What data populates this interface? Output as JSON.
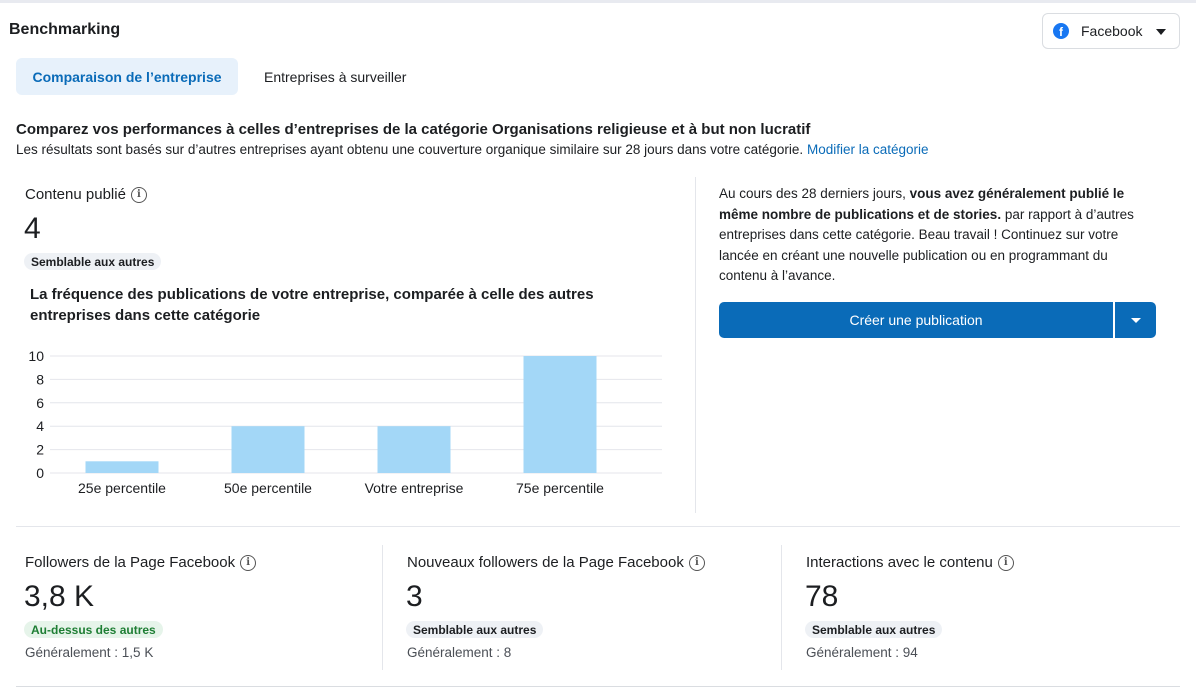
{
  "header": {
    "title": "Benchmarking",
    "platform": "Facebook"
  },
  "tabs": [
    {
      "label": "Comparaison de l’entreprise",
      "active": true
    },
    {
      "label": "Entreprises à surveiller",
      "active": false
    }
  ],
  "intro": {
    "headline": "Comparez vos performances à celles d’entreprises de la catégorie Organisations religieuse et à but non lucratif",
    "subline": "Les résultats sont basés sur d’autres entreprises ayant obtenu une couverture organique similaire sur 28 jours dans votre catégorie.",
    "link": "Modifier la catégorie"
  },
  "content_metric": {
    "label": "Contenu publié",
    "value": "4",
    "badge": "Semblable aux autres"
  },
  "chart_title": "La fréquence des publications de votre entreprise, comparée à celle des autres entreprises dans cette catégorie",
  "chart_data": {
    "type": "bar",
    "categories": [
      "25e percentile",
      "50e percentile",
      "Votre entreprise",
      "75e percentile"
    ],
    "values": [
      1,
      4,
      4,
      10
    ],
    "yticks": [
      0,
      2,
      4,
      6,
      8,
      10
    ],
    "ylim": [
      0,
      10
    ],
    "grid": true,
    "bar_color": "#a3d7f7"
  },
  "insight": {
    "prefix": "Au cours des 28 derniers jours, ",
    "bold": "vous avez généralement publié le même nombre de publications et de stories.",
    "suffix": " par rapport à d’autres entreprises dans cette catégorie. Beau travail ! Continuez sur votre lancée en créant une nouvelle publication ou en programmant du contenu à l’avance."
  },
  "create_button": {
    "label": "Créer une publication"
  },
  "bottom_metrics": [
    {
      "label": "Followers de la Page Facebook",
      "value": "3,8 K",
      "badge": "Au-dessus des autres",
      "typical": "Généralement : 1,5 K"
    },
    {
      "label": "Nouveaux followers de la Page Facebook",
      "value": "3",
      "badge": "Semblable aux autres",
      "typical": "Généralement : 8"
    },
    {
      "label": "Interactions avec le contenu",
      "value": "78",
      "badge": "Semblable aux autres",
      "typical": "Généralement : 94"
    }
  ],
  "colors": {
    "accent": "#0a6bb8",
    "bar": "#a3d7f7",
    "badge_green_bg": "#e6f4ea",
    "badge_green_text": "#1e7e34"
  }
}
